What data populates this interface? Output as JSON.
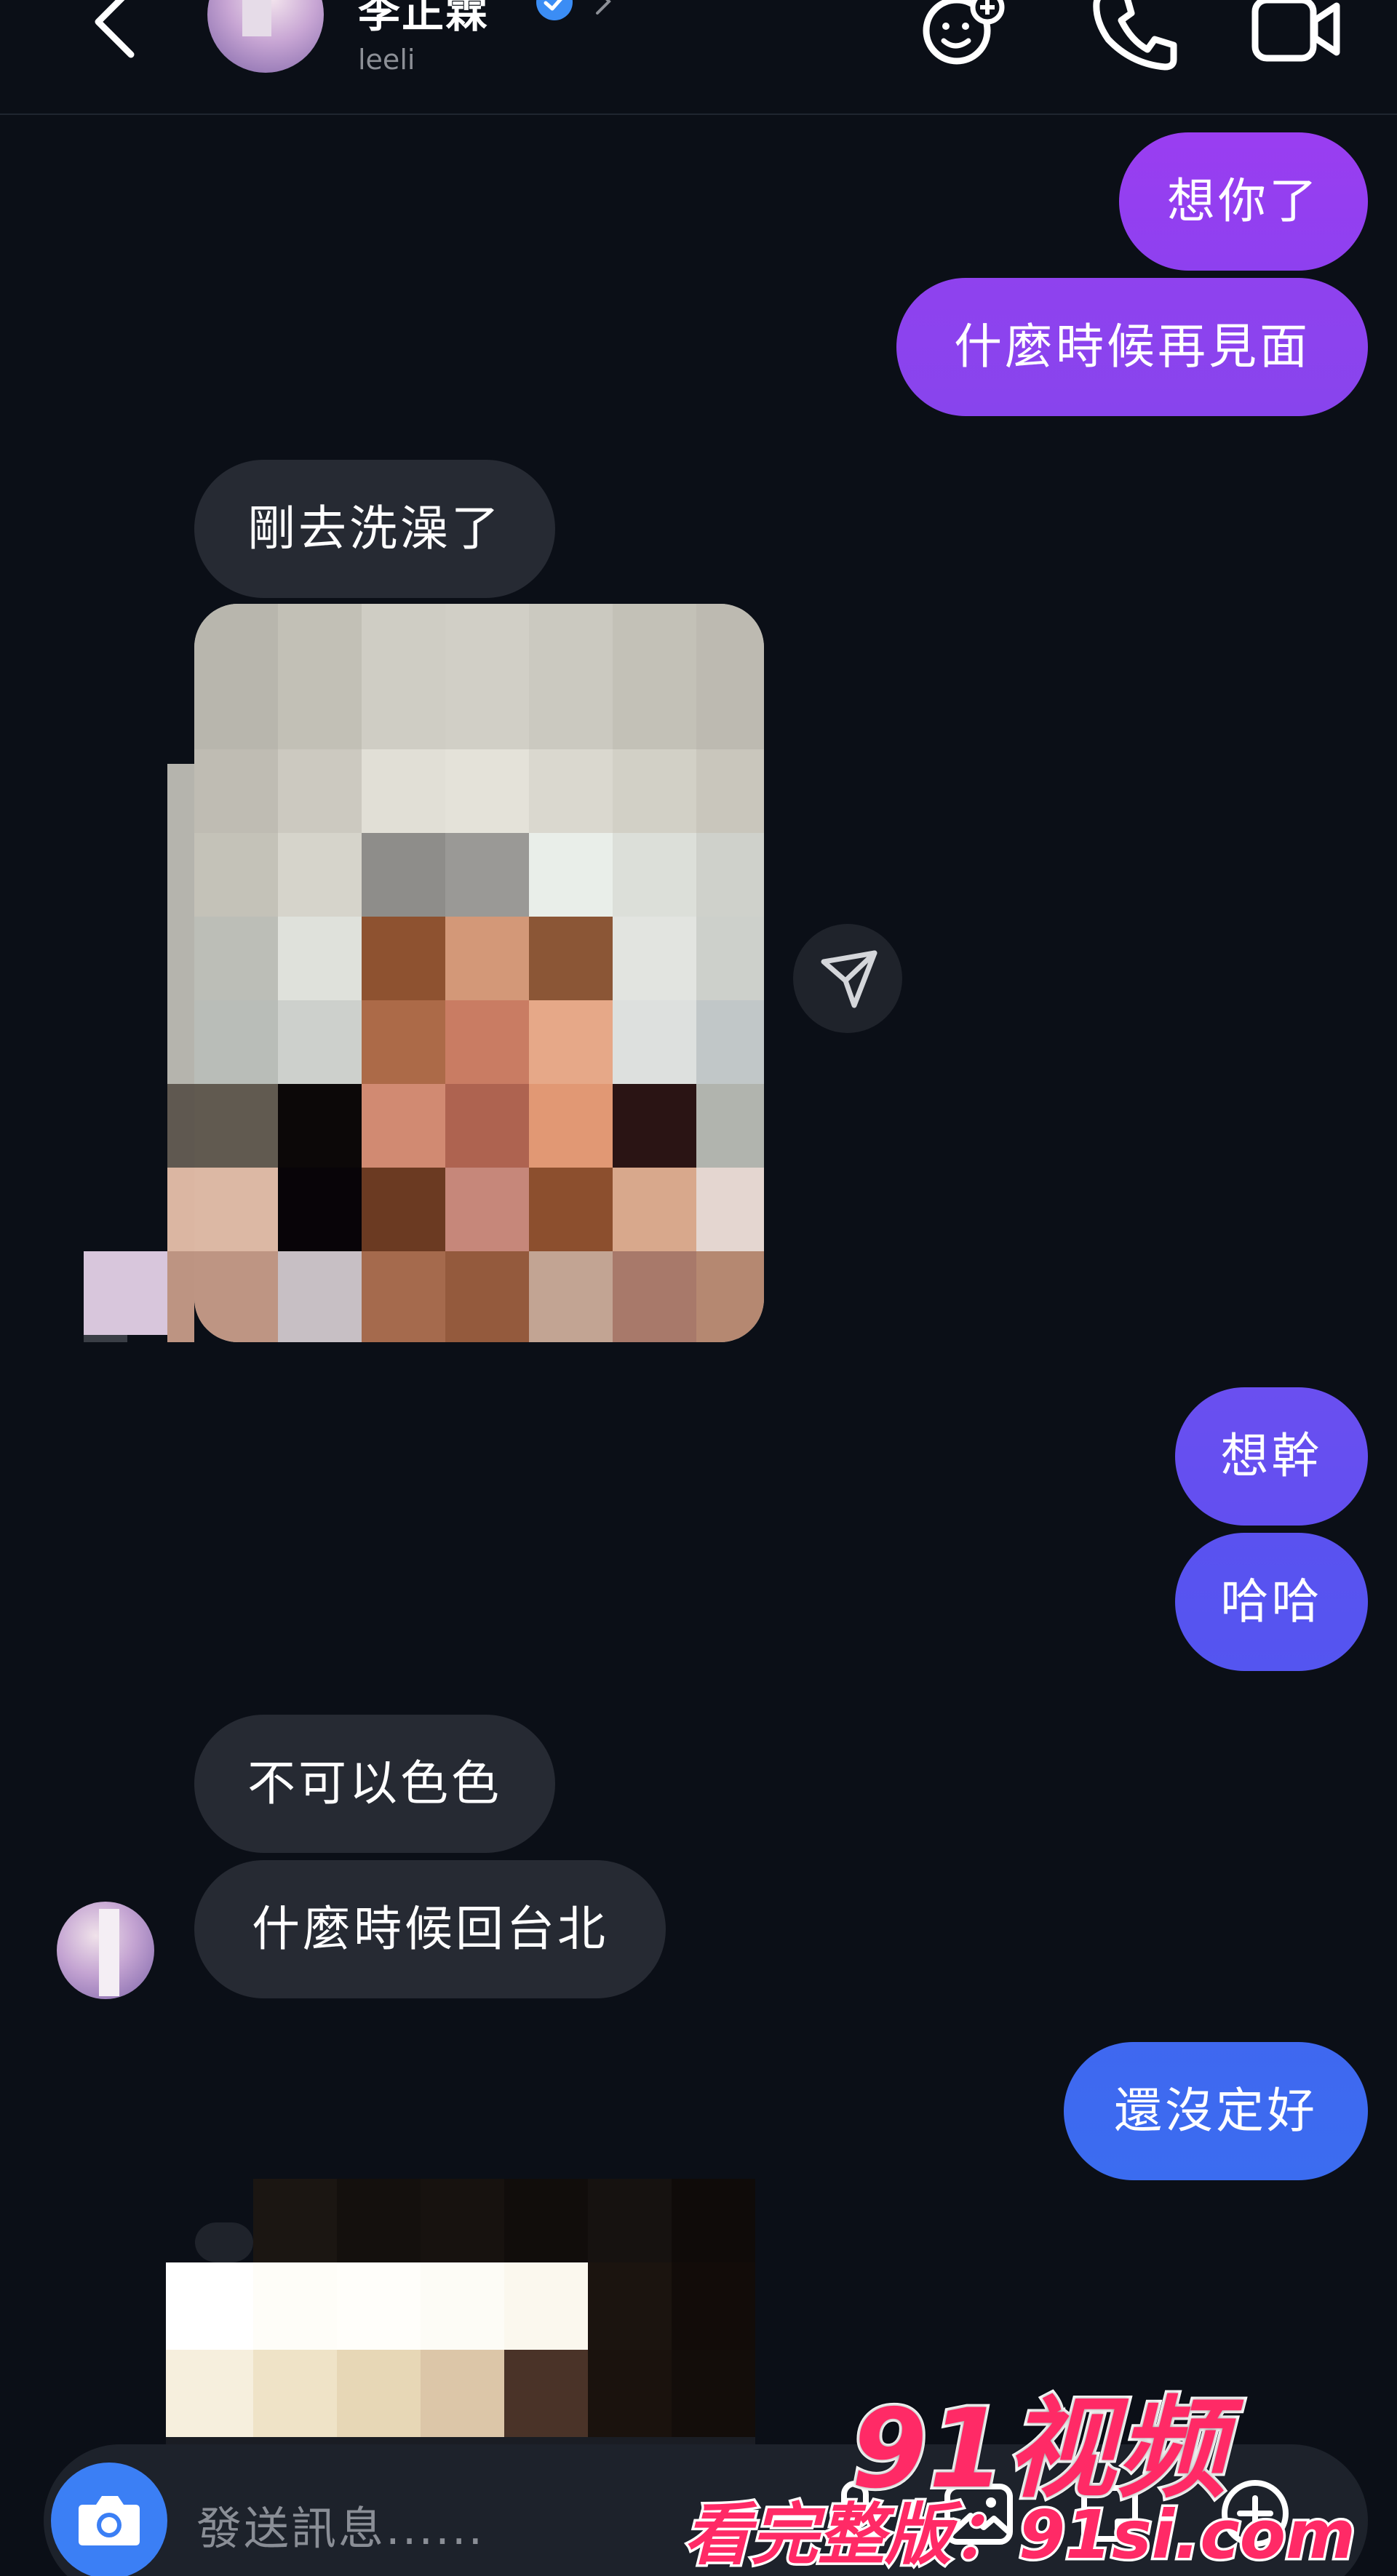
{
  "header": {
    "contact_name": "李正霖",
    "contact_username": "leeli",
    "icons": [
      "back-arrow-icon",
      "verified-badge-icon",
      "chevron-right-icon",
      "avatar-effects-icon",
      "phone-call-icon",
      "video-call-icon"
    ]
  },
  "messages": [
    {
      "side": "out",
      "text": "想你了"
    },
    {
      "side": "out",
      "text": "什麼時候再見面"
    },
    {
      "side": "in",
      "text": "剛去洗澡了"
    },
    {
      "side": "in",
      "type": "image",
      "content": "pixelated photo"
    },
    {
      "side": "out",
      "text": "想幹"
    },
    {
      "side": "out",
      "text": "哈哈"
    },
    {
      "side": "in",
      "text": "不可以色色"
    },
    {
      "side": "in",
      "text": "什麼時候回台北"
    },
    {
      "side": "out",
      "text": "還沒定好"
    },
    {
      "side": "in",
      "type": "image",
      "content": "pixelated photo"
    }
  ],
  "composer": {
    "placeholder": "發送訊息......",
    "icons": [
      "camera-icon",
      "microphone-icon",
      "gallery-icon",
      "sticker-icon",
      "add-icon"
    ]
  },
  "watermark": {
    "title": "91视频",
    "subtitle": "看完整版：91si.com"
  },
  "colors": {
    "background": "#0b0f17",
    "incoming_bubble": "#262a33",
    "outgoing_gradient_top": "#9c3cf0",
    "outgoing_gradient_bottom": "#3b6cf0",
    "camera_button": "#3b7ff5",
    "watermark": "#ff2a66"
  }
}
